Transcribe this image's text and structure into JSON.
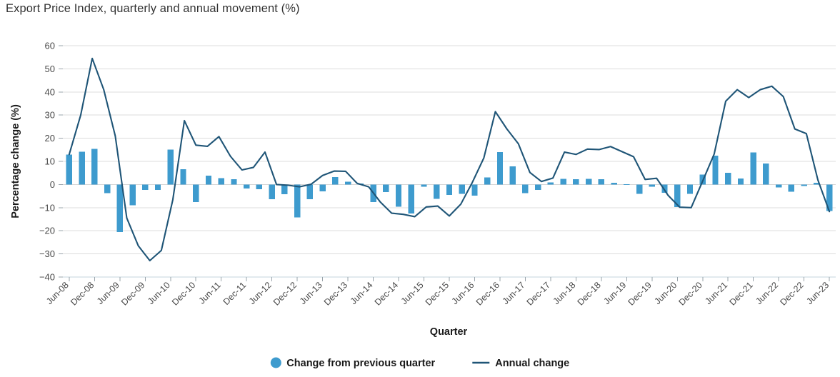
{
  "header": {
    "title": "Export Price Index, quarterly and annual movement (%)"
  },
  "legend": {
    "position": "bottom-center",
    "items": [
      {
        "label": "Change from previous quarter",
        "marker": "circle",
        "color": "#3e9bce"
      },
      {
        "label": "Annual change",
        "marker": "line",
        "color": "#1f5577"
      }
    ]
  },
  "chart_data": {
    "type": "bar",
    "title": "Export Price Index, quarterly and annual movement (%)",
    "xlabel": "Quarter",
    "ylabel": "Percentage change (%)",
    "ylim": [
      -40,
      60
    ],
    "ytick_step": 10,
    "yticks": [
      60,
      50,
      40,
      30,
      20,
      10,
      0,
      -10,
      -20,
      -30,
      -40
    ],
    "grid": true,
    "grid_axis": "y",
    "bar_color": "#3e9bce",
    "line_color": "#1f5577",
    "categories": [
      "Jun-08",
      "Sep-08",
      "Dec-08",
      "Mar-09",
      "Jun-09",
      "Sep-09",
      "Dec-09",
      "Mar-10",
      "Jun-10",
      "Sep-10",
      "Dec-10",
      "Mar-11",
      "Jun-11",
      "Sep-11",
      "Dec-11",
      "Mar-12",
      "Jun-12",
      "Sep-12",
      "Dec-12",
      "Mar-13",
      "Jun-13",
      "Sep-13",
      "Dec-13",
      "Mar-14",
      "Jun-14",
      "Sep-14",
      "Dec-14",
      "Mar-15",
      "Jun-15",
      "Sep-15",
      "Dec-15",
      "Mar-16",
      "Jun-16",
      "Sep-16",
      "Dec-16",
      "Mar-17",
      "Jun-17",
      "Sep-17",
      "Dec-17",
      "Mar-18",
      "Jun-18",
      "Sep-18",
      "Dec-18",
      "Mar-19",
      "Jun-19",
      "Sep-19",
      "Dec-19",
      "Mar-20",
      "Jun-20",
      "Sep-20",
      "Dec-20",
      "Mar-21",
      "Jun-21",
      "Sep-21",
      "Dec-21",
      "Mar-22",
      "Jun-22",
      "Sep-22",
      "Dec-22",
      "Mar-23",
      "Jun-23"
    ],
    "xtick_labels": [
      "Jun-08",
      "Dec-08",
      "Jun-09",
      "Dec-09",
      "Jun-10",
      "Dec-10",
      "Jun-11",
      "Dec-11",
      "Jun-12",
      "Dec-12",
      "Jun-13",
      "Dec-13",
      "Jun-14",
      "Dec-14",
      "Jun-15",
      "Dec-15",
      "Jun-16",
      "Dec-16",
      "Jun-17",
      "Dec-17",
      "Jun-18",
      "Dec-18",
      "Jun-19",
      "Dec-19",
      "Jun-20",
      "Dec-20",
      "Jun-21",
      "Dec-21",
      "Jun-22",
      "Dec-22",
      "Jun-23"
    ],
    "series": [
      {
        "name": "Change from previous quarter",
        "type": "bar",
        "color": "#3e9bce",
        "values": [
          13.0,
          14.2,
          15.4,
          -3.7,
          -20.5,
          -9.0,
          -2.3,
          -2.3,
          15.1,
          6.6,
          -7.6,
          3.8,
          2.8,
          2.3,
          -1.8,
          -2.0,
          -6.3,
          -4.2,
          -14.3,
          -6.4,
          -3.0,
          3.2,
          1.2,
          0.5,
          -7.6,
          -3.3,
          -9.6,
          -12.5,
          -1.0,
          -6.2,
          -4.5,
          -4.0,
          -4.8,
          3.0,
          14.0,
          7.8,
          -3.8,
          -2.3,
          0.9,
          2.4,
          2.3,
          2.5,
          2.3,
          0.8,
          0.2,
          -4.0,
          -0.9,
          -3.6,
          -9.8,
          -4.1,
          4.3,
          12.4,
          5.1,
          2.6,
          13.9,
          9.1,
          -1.2,
          -3.1,
          -0.7,
          0.8,
          -11.5
        ]
      },
      {
        "name": "Annual change",
        "type": "line",
        "color": "#1f5577",
        "values": [
          13.0,
          30.0,
          54.5,
          41.0,
          21.0,
          -14.5,
          -26.5,
          -32.9,
          -28.5,
          -6.5,
          27.6,
          17.0,
          16.5,
          20.7,
          12.2,
          6.3,
          7.4,
          14.0,
          0.0,
          -0.3,
          -1.0,
          0.1,
          3.9,
          5.8,
          5.7,
          0.5,
          -1.0,
          -7.5,
          -12.4,
          -12.9,
          -13.9,
          -9.7,
          -9.3,
          -13.6,
          -8.5,
          0.9,
          11.5,
          31.5,
          24.0,
          17.6,
          5.2,
          1.3,
          2.8,
          14.0,
          13.0,
          15.3,
          15.1,
          16.4,
          14.2,
          12.0,
          2.2,
          2.7,
          -4.7,
          -9.8,
          -10.0,
          1.5,
          13.2,
          36.0,
          41.0,
          37.6,
          41.0,
          42.5,
          38.0,
          24.0,
          22.0,
          2.0,
          -11.7
        ]
      }
    ]
  }
}
